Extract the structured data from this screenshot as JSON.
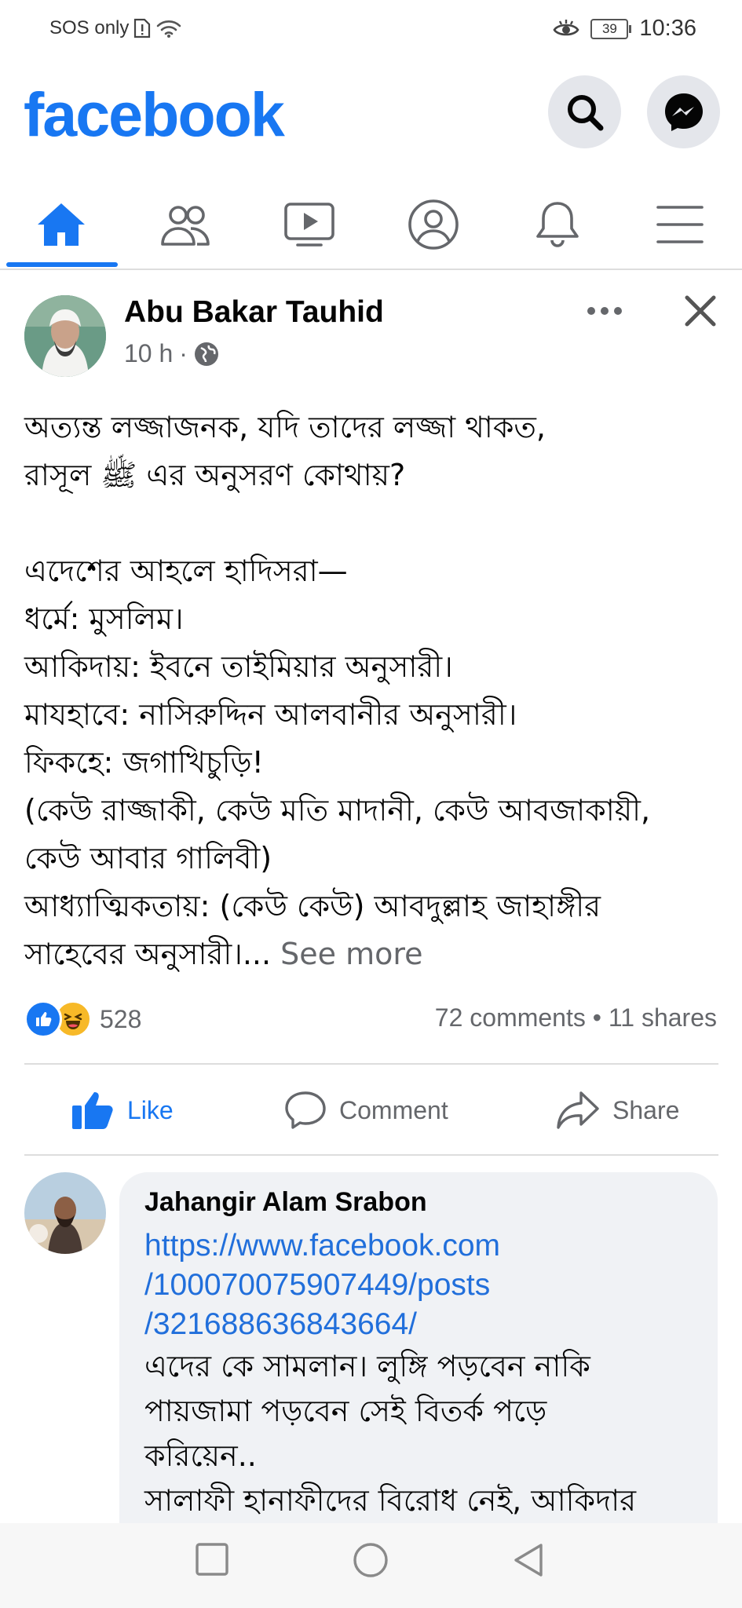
{
  "status_bar": {
    "network": "SOS only",
    "battery": "39",
    "time": "10:36"
  },
  "header": {
    "logo": "facebook",
    "search_icon": "search-icon",
    "messenger_icon": "messenger-icon"
  },
  "nav": {
    "tabs": [
      {
        "icon": "home-icon",
        "active": true
      },
      {
        "icon": "friends-icon"
      },
      {
        "icon": "watch-icon"
      },
      {
        "icon": "profile-icon"
      },
      {
        "icon": "bell-icon"
      },
      {
        "icon": "menu-icon"
      }
    ],
    "accent": "#1877f2"
  },
  "post": {
    "author": "Abu Bakar Tauhid",
    "time": "10 h",
    "separator": "·",
    "privacy_icon": "globe-icon",
    "body_lines": [
      "অত্যন্ত লজ্জাজনক,  যদি তাদের লজ্জা থাকত,",
      "রাসূল ﷺ এর অনুসরণ কোথায়?",
      "",
      "এদেশের আহলে হাদিসরা—",
      "ধর্মে: মুসলিম।",
      "আকিদায়: ইবনে তাইমিয়ার অনুসারী।",
      "মাযহাবে: নাসিরুদ্দিন আলবানীর অনুসারী।",
      "ফিকহে: জগাখিচুড়ি!",
      "(কেউ রাজ্জাকী, কেউ মতি মাদানী, কেউ আবজাকায়ী,",
      "কেউ আবার গালিবী)",
      "আধ্যাত্মিকতায়: (কেউ কেউ) আবদুল্লাহ জাহাঙ্গীর"
    ],
    "last_line": "সাহেবের অনুসারী।...",
    "see_more": "See more",
    "reaction_count": "528",
    "stats": "72 comments • 11 shares",
    "actions": {
      "like": "Like",
      "comment": "Comment",
      "share": "Share"
    }
  },
  "comment": {
    "author": "Jahangir Alam Srabon",
    "link_lines": [
      "https://www.facebook.com",
      "/100070075907449/posts",
      "/321688636843664/"
    ],
    "text_lines": [
      "এদের কে সামলান। লুঙ্গি পড়বেন নাকি",
      "পায়জামা পড়বেন সেই বিতর্ক পড়ে",
      "করিয়েন..",
      "সালাফী হানাফীদের বিরোধ নেই, আকিদার"
    ]
  }
}
